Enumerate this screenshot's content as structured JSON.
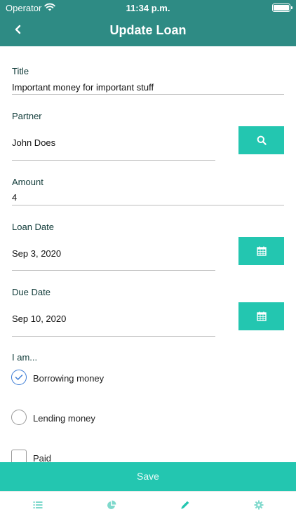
{
  "status_bar": {
    "carrier": "Operator",
    "time": "11:34 p.m."
  },
  "nav": {
    "title": "Update Loan",
    "back_icon": "chevron-left-icon"
  },
  "form": {
    "title_label": "Title",
    "title_value": "Important money for important stuff",
    "partner_label": "Partner",
    "partner_value": "John Does",
    "amount_label": "Amount",
    "amount_value": "4",
    "loan_date_label": "Loan Date",
    "loan_date_value": "Sep 3, 2020",
    "due_date_label": "Due Date",
    "due_date_value": "Sep 10, 2020",
    "role_label": "I am...",
    "options": [
      {
        "label": "Borrowing money",
        "selected": true
      },
      {
        "label": "Lending money",
        "selected": false
      }
    ],
    "paid_label": "Paid",
    "paid_checked": false
  },
  "actions": {
    "save_label": "Save"
  },
  "tabs": [
    {
      "icon": "list-icon",
      "active": false
    },
    {
      "icon": "pie-chart-icon",
      "active": false
    },
    {
      "icon": "pencil-icon",
      "active": true
    },
    {
      "icon": "gear-icon",
      "active": false
    }
  ],
  "colors": {
    "header": "#2e8b84",
    "accent": "#23c6b0",
    "tab_icon": "#7fd9cc",
    "radio_selected": "#3a7bd5"
  }
}
